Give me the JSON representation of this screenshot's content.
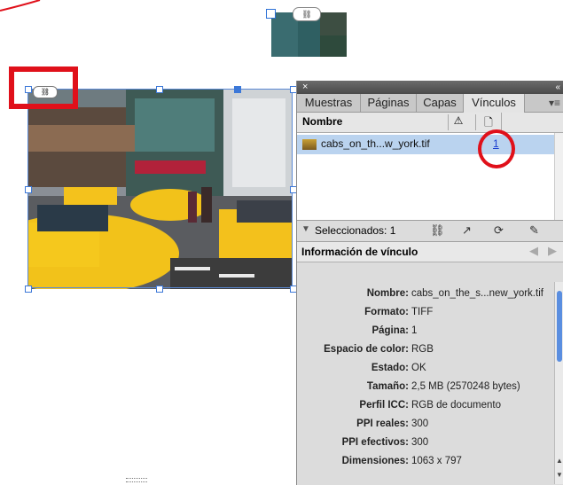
{
  "panel": {
    "close_icon": "×",
    "collapse_icon": "«",
    "tabs": [
      "Muestras",
      "Páginas",
      "Capas",
      "Vínculos"
    ],
    "active_tab": "Vínculos",
    "menu_icon": "▾≡",
    "column_name": "Nombre",
    "column_warning_icon": "⚠",
    "column_page_icon": "🗋",
    "links": [
      {
        "name": "cabs_on_th...w_york.tif",
        "page": "1"
      }
    ],
    "toolbar": {
      "selected_label": "Seleccionados: 1",
      "icons": [
        "relink-icon",
        "go-to-link-icon",
        "update-link-icon",
        "edit-original-icon"
      ]
    },
    "info_title": "Información de vínculo",
    "info_rows": [
      {
        "label": "Nombre:",
        "value": "cabs_on_the_s...new_york.tif"
      },
      {
        "label": "Formato:",
        "value": "TIFF"
      },
      {
        "label": "Página:",
        "value": "1"
      },
      {
        "label": "Espacio de color:",
        "value": "RGB"
      },
      {
        "label": "Estado:",
        "value": "OK"
      },
      {
        "label": "Tamaño:",
        "value": "2,5 MB (2570248 bytes)"
      },
      {
        "label": "Perfil ICC:",
        "value": "RGB de documento"
      },
      {
        "label": "PPI reales:",
        "value": "300"
      },
      {
        "label": "PPI efectivos:",
        "value": "300"
      },
      {
        "label": "Dimensiones:",
        "value": "1063 x 797"
      }
    ]
  },
  "colors": {
    "annotation_red": "#e0101a",
    "selection_blue": "#3c78d8",
    "row_highlight": "#bad3ef"
  }
}
